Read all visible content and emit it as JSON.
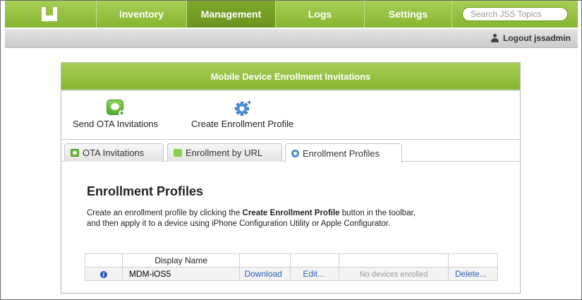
{
  "nav": {
    "items": [
      {
        "label": "Inventory",
        "active": false
      },
      {
        "label": "Management",
        "active": true
      },
      {
        "label": "Logs",
        "active": false
      },
      {
        "label": "Settings",
        "active": false
      }
    ],
    "search_placeholder": "Search JSS Topics"
  },
  "subbar": {
    "logout_label": "Logout jssadmin"
  },
  "panel": {
    "title": "Mobile Device Enrollment Invitations",
    "toolbar": {
      "send_ota_label": "Send OTA Invitations",
      "create_profile_label": "Create Enrollment Profile"
    },
    "tabs": [
      {
        "label": "OTA Invitations",
        "active": false
      },
      {
        "label": "Enrollment by URL",
        "active": false
      },
      {
        "label": "Enrollment Profiles",
        "active": true
      }
    ],
    "section_title": "Enrollment Profiles",
    "description": {
      "part1": "Create an enrollment profile by clicking the ",
      "bold": "Create Enrollment Profile",
      "part2": " button in the toolbar,",
      "line2": "and then apply it to a device using iPhone Configuration Utility or Apple Configurator."
    },
    "table": {
      "header_display_name": "Display Name",
      "row": {
        "name": "MDM-iOS5",
        "download": "Download",
        "edit": "Edit...",
        "status": "No devices enrolled",
        "delete": "Delete..."
      }
    }
  },
  "colors": {
    "nav_green": "#97c244",
    "nav_active": "#76a129",
    "link_blue": "#2c5fb0"
  }
}
